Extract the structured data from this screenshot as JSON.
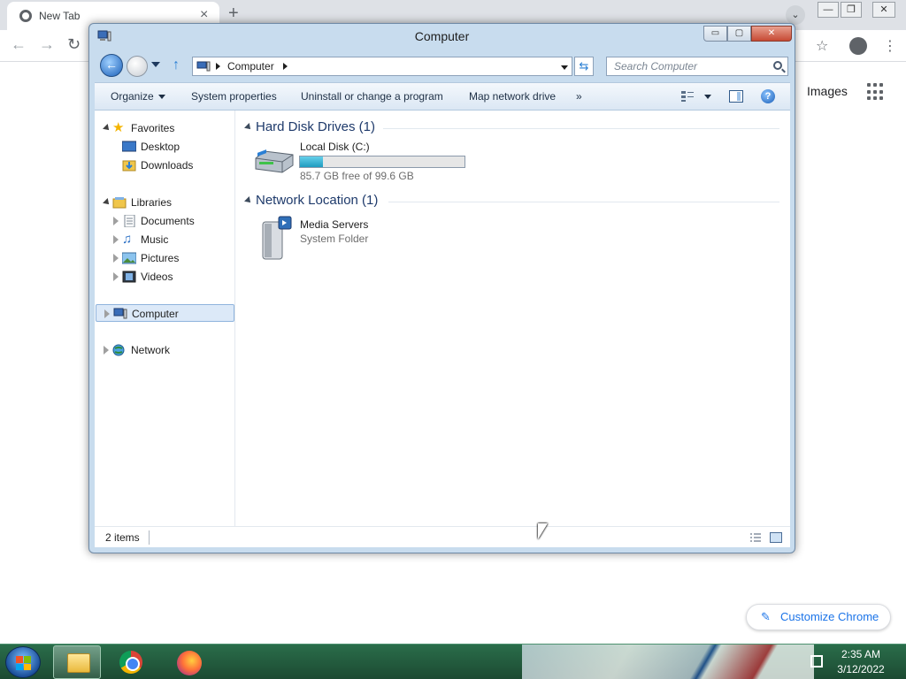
{
  "chrome": {
    "tab_title": "New Tab",
    "images_link": "Images",
    "customize_label": "Customize Chrome"
  },
  "window": {
    "title": "Computer",
    "controls": {
      "minimize": "▭",
      "maximize": "▢",
      "close": "✕"
    }
  },
  "address": {
    "path": "Computer",
    "search_placeholder": "Search Computer"
  },
  "command_bar": {
    "organize": "Organize",
    "system_properties": "System properties",
    "uninstall": "Uninstall or change a program",
    "map_drive": "Map network drive",
    "more": "»"
  },
  "nav_pane": {
    "favorites": {
      "label": "Favorites",
      "items": [
        "Desktop",
        "Downloads"
      ]
    },
    "libraries": {
      "label": "Libraries",
      "items": [
        "Documents",
        "Music",
        "Pictures",
        "Videos"
      ]
    },
    "computer": "Computer",
    "network": "Network"
  },
  "main": {
    "hard_disk_group": "Hard Disk Drives (1)",
    "local_disk": {
      "name": "Local Disk (C:)",
      "free_text": "85.7 GB free of 99.6 GB",
      "used_fraction": 0.14
    },
    "network_group": "Network Location (1)",
    "media_servers": {
      "name": "Media Servers",
      "type": "System Folder"
    }
  },
  "status": {
    "items_count": "2 items"
  },
  "taskbar": {
    "time": "2:35 AM",
    "date": "3/12/2022"
  },
  "colors": {
    "accent": "#1a73e8",
    "progress_fill": "#1e9bbf",
    "taskbar": "#1c4a32"
  }
}
